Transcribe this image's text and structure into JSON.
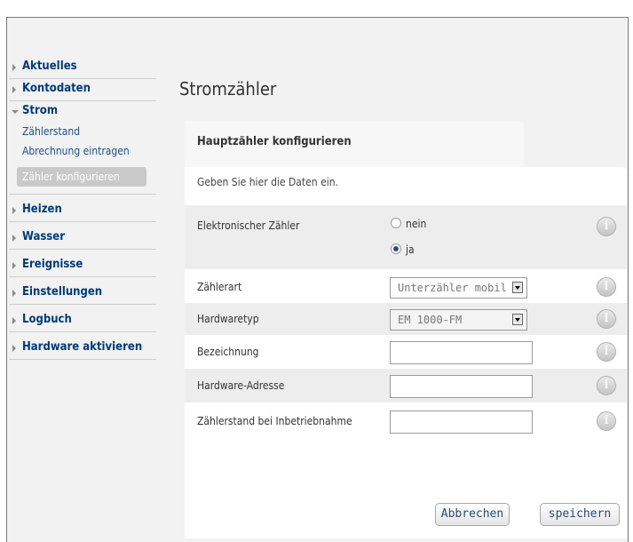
{
  "sidebar": {
    "items": [
      {
        "label": "Aktuelles"
      },
      {
        "label": "Kontodaten"
      },
      {
        "label": "Strom"
      },
      {
        "label": "Heizen"
      },
      {
        "label": "Wasser"
      },
      {
        "label": "Ereignisse"
      },
      {
        "label": "Einstellungen"
      },
      {
        "label": "Logbuch"
      },
      {
        "label": "Hardware aktivieren"
      }
    ],
    "strom_subitems": [
      {
        "label": "Zählerstand"
      },
      {
        "label": "Abrechnung eintragen"
      },
      {
        "label": "Zähler konfigurieren"
      }
    ]
  },
  "main": {
    "title": "Stromzähler",
    "panel_title": "Hauptzähler konfigurieren",
    "intro": "Geben Sie hier die Daten ein.",
    "fields": {
      "elektronisch": {
        "label": "Elektronischer Zähler",
        "option_no": "nein",
        "option_yes": "ja",
        "selected": "ja"
      },
      "zaehlerart": {
        "label": "Zählerart",
        "value": "Unterzähler mobil"
      },
      "hardwaretyp": {
        "label": "Hardwaretyp",
        "value": "EM 1000-FM"
      },
      "bezeichnung": {
        "label": "Bezeichnung",
        "value": ""
      },
      "hardware_adresse": {
        "label": "Hardware-Adresse",
        "value": ""
      },
      "zaehlerstand": {
        "label": "Zählerstand bei Inbetriebnahme",
        "value": ""
      }
    },
    "buttons": {
      "cancel": "Abbrechen",
      "save": "speichern"
    }
  }
}
